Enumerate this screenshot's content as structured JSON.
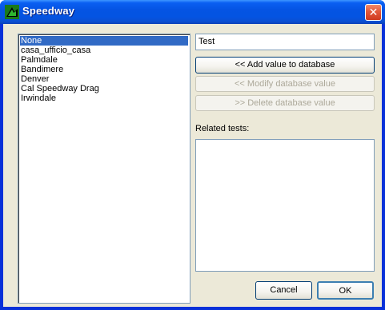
{
  "window": {
    "title": "Speedway",
    "close_glyph": "✕",
    "app_icon": "speedway-app-icon"
  },
  "speedway_list": {
    "items": [
      {
        "label": "None",
        "selected": true
      },
      {
        "label": "casa_ufficio_casa",
        "selected": false
      },
      {
        "label": "Palmdale",
        "selected": false
      },
      {
        "label": "Bandimere",
        "selected": false
      },
      {
        "label": "Denver",
        "selected": false
      },
      {
        "label": "Cal Speedway Drag",
        "selected": false
      },
      {
        "label": "Irwindale",
        "selected": false
      }
    ]
  },
  "value_input": {
    "value": "Test"
  },
  "actions": {
    "add_label": "<< Add value to database",
    "modify_label": "<< Modify database value",
    "delete_label": ">> Delete database value"
  },
  "related": {
    "label": "Related tests:"
  },
  "footer": {
    "cancel_label": "Cancel",
    "ok_label": "OK"
  },
  "colors": {
    "titlebar": "#0554e3",
    "selection": "#316ac5",
    "face": "#ece9d8",
    "close": "#e2583a"
  }
}
